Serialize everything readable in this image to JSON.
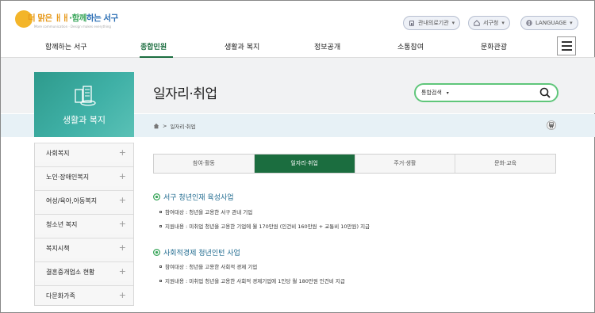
{
  "header": {
    "logo": {
      "part1": "더 맑은 ㅐㅐ",
      "part2": "·함께",
      "part3": "하는 서구",
      "subtitle": "More communication · Design makes everything"
    },
    "buttons": [
      {
        "label": "관내의료기관"
      },
      {
        "label": "서구청"
      },
      {
        "label": "LANGUAGE"
      }
    ]
  },
  "nav": {
    "items": [
      "함께하는 서구",
      "종합민원",
      "생활과 복지",
      "정보공개",
      "소통참여",
      "문화관광"
    ],
    "active": "종합민원"
  },
  "sidebar": {
    "title": "생활과 복지",
    "items": [
      {
        "label": "사회복지"
      },
      {
        "label": "노인·장애인복지"
      },
      {
        "label": "여성/육아,아동복지"
      },
      {
        "label": "청소년 복지"
      },
      {
        "label": "복지시책"
      },
      {
        "label": "결혼중개업소 현황"
      },
      {
        "label": "다문화가족"
      }
    ]
  },
  "content": {
    "title": "일자리·취업",
    "search": {
      "scope": "통합검색"
    },
    "breadcrumb": {
      "separator": ">",
      "current": "일자리·취업"
    },
    "tabs": [
      {
        "label": "참여·활동"
      },
      {
        "label": "일자리·취업"
      },
      {
        "label": "주거·생활"
      },
      {
        "label": "문화·교육"
      }
    ],
    "sections": [
      {
        "title": "서구 청년인재 육성사업",
        "items": [
          "참여대상 : 청년을 고용한 서구 관내 기업",
          "지원내용 : 미취업 청년을 고용한 기업에 월 170만원 (인건비 160만원 + 교통비 10만원) 지급"
        ]
      },
      {
        "title": "사회적경제 청년인턴 사업",
        "items": [
          "참여대상 : 청년을 고용한 사회적 경제 기업",
          "지원내용 : 미취업 청년을 고용한 사회적 경제기업에 1인당 월 180만원 인건비 지급"
        ]
      }
    ]
  },
  "colors": {
    "brand_green": "#1b6d3f",
    "search_border": "#5fc67a",
    "sidebar_teal": "#3fb0a6",
    "section_title": "#1f6a8f"
  }
}
